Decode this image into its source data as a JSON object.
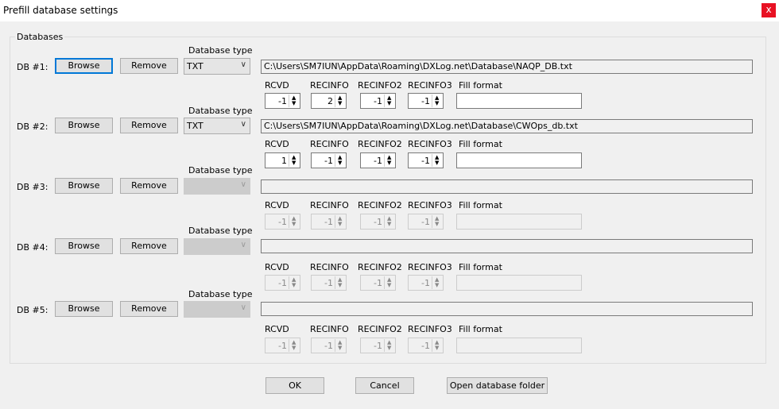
{
  "window": {
    "title": "Prefill database settings",
    "close_glyph": "x"
  },
  "group_label": "Databases",
  "labels": {
    "database_type": "Database type",
    "rcvd": "RCVD",
    "recinfo": "RECINFO",
    "recinfo2": "RECINFO2",
    "recinfo3": "RECINFO3",
    "fill_format": "Fill format",
    "browse": "Browse",
    "remove": "Remove"
  },
  "databases": [
    {
      "label": "DB #1:",
      "type": "TXT",
      "path": "C:\\Users\\SM7IUN\\AppData\\Roaming\\DXLog.net\\Database\\NAQP_DB.txt",
      "rcvd": "-1",
      "recinfo": "2",
      "recinfo2": "-1",
      "recinfo3": "-1",
      "fill_format": ""
    },
    {
      "label": "DB #2:",
      "type": "TXT",
      "path": "C:\\Users\\SM7IUN\\AppData\\Roaming\\DXLog.net\\Database\\CWOps_db.txt",
      "rcvd": "1",
      "recinfo": "-1",
      "recinfo2": "-1",
      "recinfo3": "-1",
      "fill_format": ""
    },
    {
      "label": "DB #3:",
      "type": "",
      "path": "",
      "rcvd": "-1",
      "recinfo": "-1",
      "recinfo2": "-1",
      "recinfo3": "-1",
      "fill_format": ""
    },
    {
      "label": "DB #4:",
      "type": "",
      "path": "",
      "rcvd": "-1",
      "recinfo": "-1",
      "recinfo2": "-1",
      "recinfo3": "-1",
      "fill_format": ""
    },
    {
      "label": "DB #5:",
      "type": "",
      "path": "",
      "rcvd": "-1",
      "recinfo": "-1",
      "recinfo2": "-1",
      "recinfo3": "-1",
      "fill_format": ""
    }
  ],
  "buttons": {
    "ok": "OK",
    "cancel": "Cancel",
    "open_folder": "Open database folder"
  }
}
